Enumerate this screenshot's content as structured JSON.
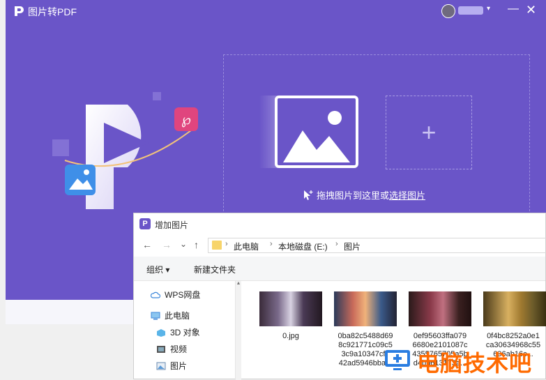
{
  "app": {
    "logo_letter": "P",
    "title": "图片转PDF",
    "user_caret": "▾",
    "minimize": "—",
    "close": "✕",
    "accent": "#6a55c8"
  },
  "dropzone": {
    "add_plus": "+",
    "hint_prefix": "拖拽图片到这里或",
    "hint_link": "选择图片"
  },
  "dialog": {
    "logo_letter": "P",
    "title": "增加图片",
    "nav": {
      "back": "←",
      "forward": "→",
      "recent": "⌄",
      "up": "↑"
    },
    "breadcrumb": [
      "此电脑",
      "本地磁盘 (E:)",
      "图片"
    ],
    "breadcrumb_sep": "›",
    "toolbar": {
      "organize": "组织 ▾",
      "new_folder": "新建文件夹"
    },
    "sidebar": [
      {
        "label": "WPS网盘",
        "icon": "cloud-icon"
      },
      {
        "label": "此电脑",
        "icon": "computer-icon"
      },
      {
        "label": "3D 对象",
        "icon": "cube-icon"
      },
      {
        "label": "视频",
        "icon": "video-icon"
      },
      {
        "label": "图片",
        "icon": "picture-icon"
      }
    ],
    "files": [
      {
        "name_lines": [
          "0.jpg"
        ]
      },
      {
        "name_lines": [
          "0ba82c5488d69",
          "8c921771c09c5",
          "3c9a10347cf7",
          "42ad5946bba..."
        ]
      },
      {
        "name_lines": [
          "0ef95603ffa079",
          "6680e2101087c",
          "4355765705a5b",
          "d4bb613173a..."
        ]
      },
      {
        "name_lines": [
          "0f4bc8252a0e1",
          "ca30634968c55",
          "696ab16c..."
        ]
      }
    ]
  },
  "watermark": {
    "text": "电脑技术吧"
  }
}
